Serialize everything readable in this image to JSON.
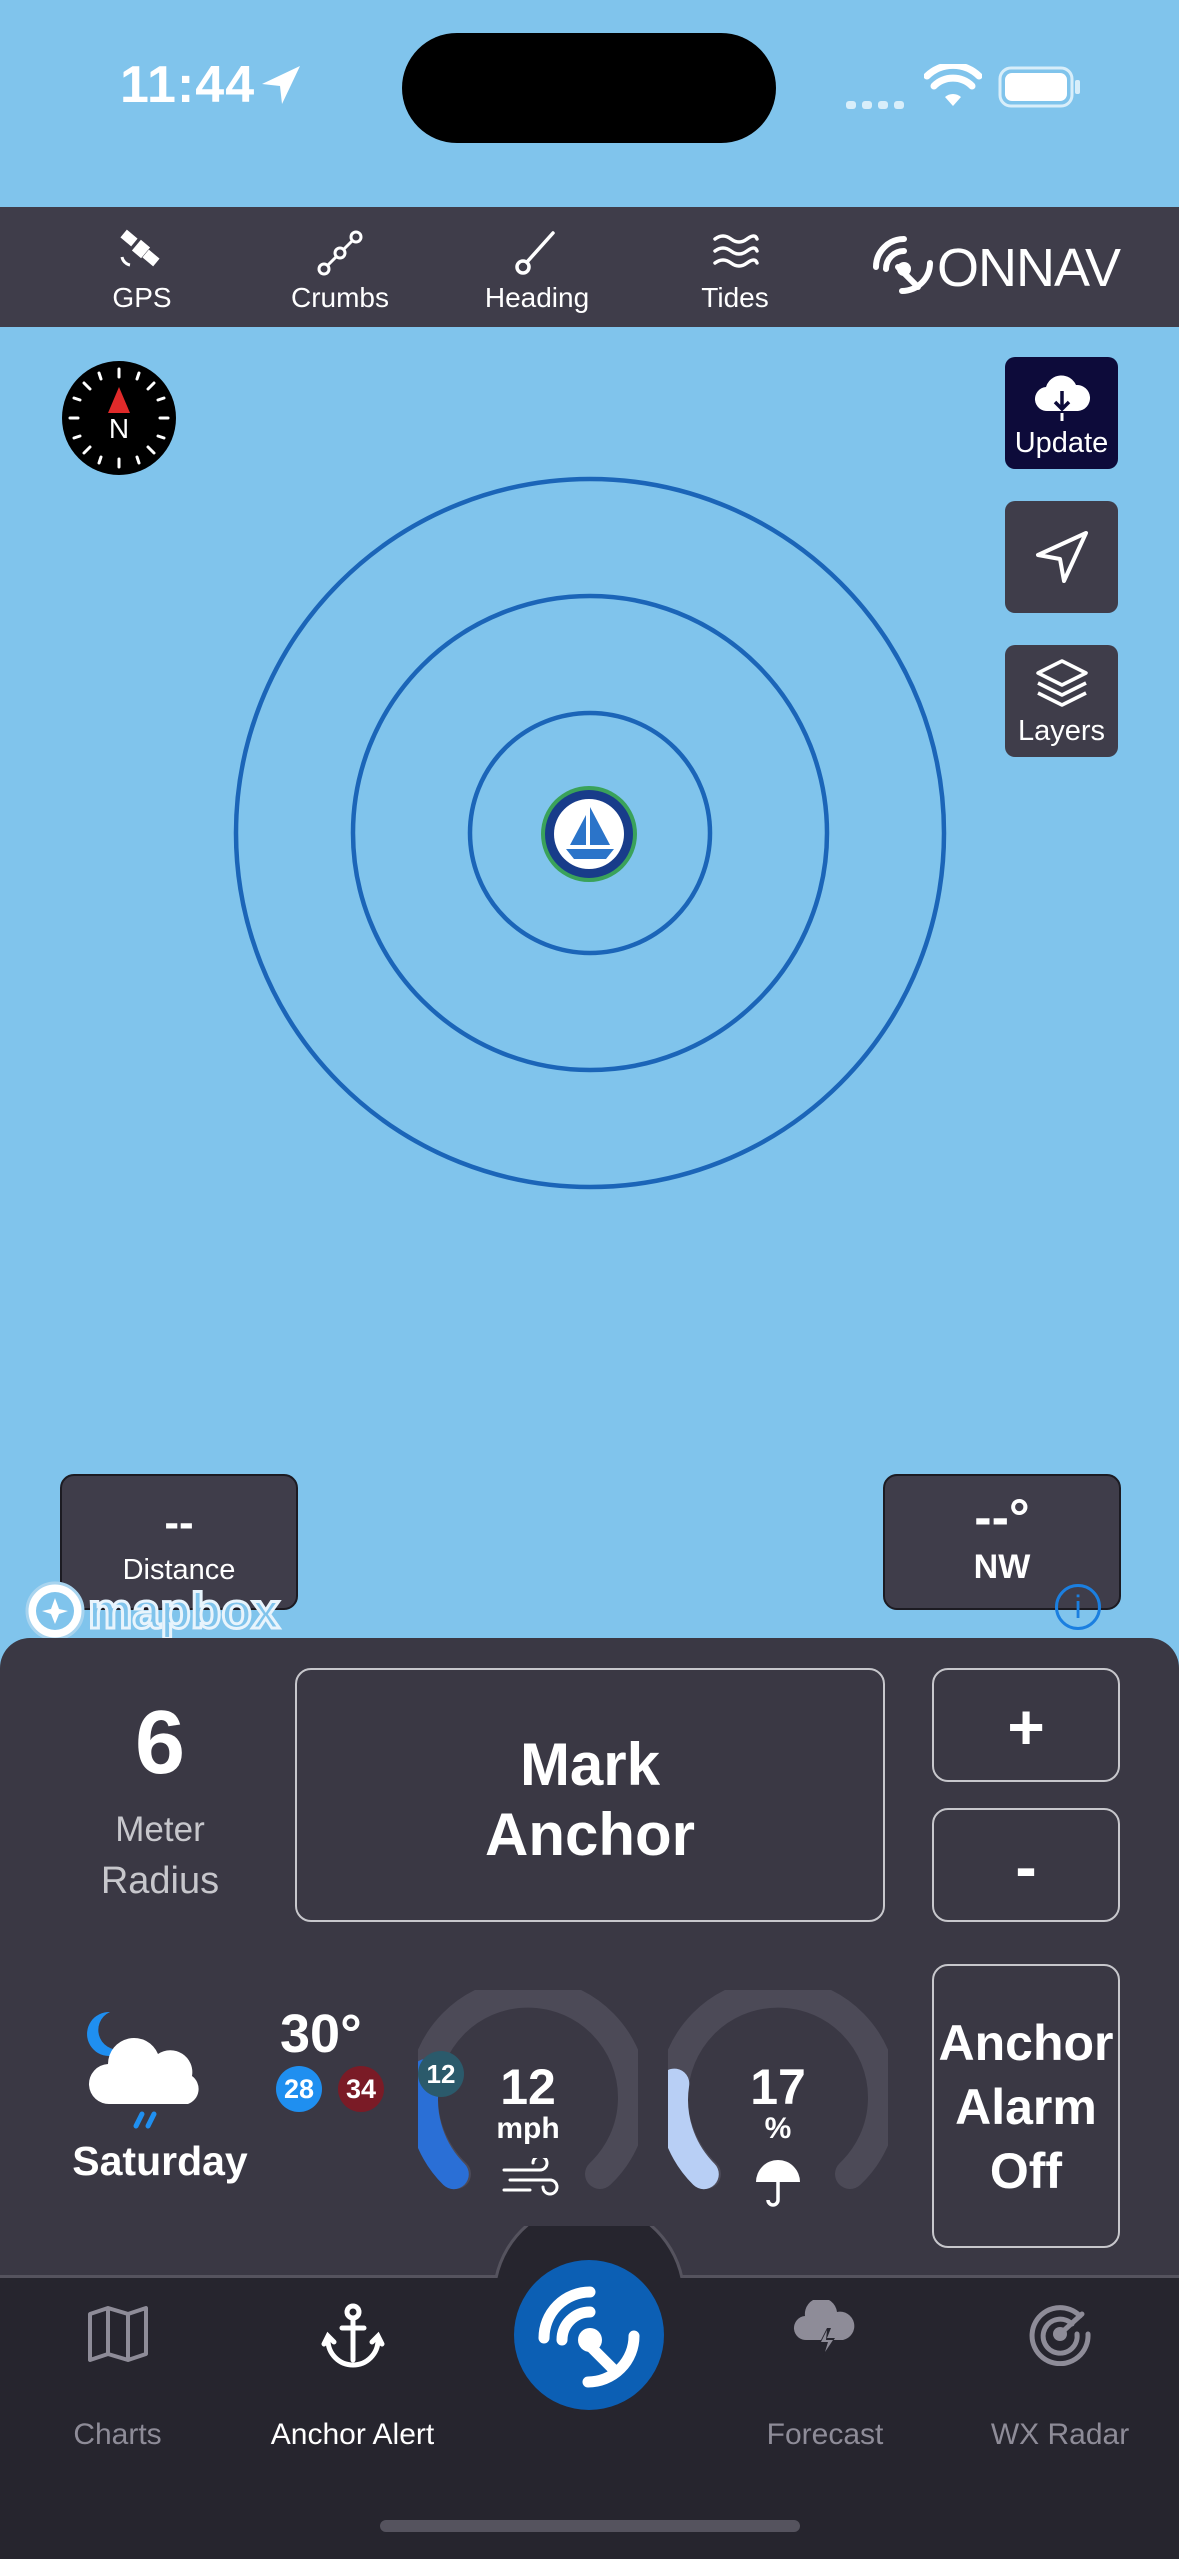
{
  "status_bar": {
    "time": "11:44"
  },
  "toolbar": {
    "items": [
      {
        "label": "GPS",
        "icon": "satellite-icon"
      },
      {
        "label": "Crumbs",
        "icon": "breadcrumbs-icon"
      },
      {
        "label": "Heading",
        "icon": "heading-icon"
      },
      {
        "label": "Tides",
        "icon": "tides-icon"
      }
    ],
    "logo_text": "ONNAV"
  },
  "map": {
    "compass_label": "N",
    "buttons": {
      "update": "Update",
      "layers": "Layers"
    },
    "distance": {
      "value": "--",
      "label": "Distance"
    },
    "bearing": {
      "value": "--°",
      "label": "NW"
    },
    "attribution": "mapbox",
    "info_symbol": "i"
  },
  "anchor": {
    "radius_value": "6",
    "radius_unit": "Meter",
    "radius_label": "Radius",
    "mark_line1": "Mark",
    "mark_line2": "Anchor",
    "plus": "+",
    "minus": "-",
    "alarm_line1": "Anchor",
    "alarm_line2": "Alarm",
    "alarm_line3": "Off"
  },
  "weather": {
    "day": "Saturday",
    "temp": "30°",
    "low": "28",
    "high": "34",
    "wind_value": "12",
    "wind_unit": "mph",
    "wind_gust": "12",
    "rain_value": "17",
    "rain_unit": "%",
    "wind_gauge_fraction": 0.22,
    "rain_gauge_fraction": 0.2
  },
  "tabbar": {
    "tabs": [
      {
        "label": "Charts",
        "icon": "map-icon"
      },
      {
        "label": "Anchor Alert",
        "icon": "anchor-icon"
      },
      {
        "label": "Forecast",
        "icon": "storm-cloud-icon"
      },
      {
        "label": "WX Radar",
        "icon": "radar-icon"
      }
    ]
  },
  "colors": {
    "map_water": "#80c4ec",
    "toolbar_bg": "#3f3d4a",
    "panel_bg": "#3a3844",
    "accent_blue": "#0c5fb4",
    "ring_blue": "#1b65b8",
    "low_temp": "#1f8ff0",
    "high_temp": "#7a1b26"
  }
}
